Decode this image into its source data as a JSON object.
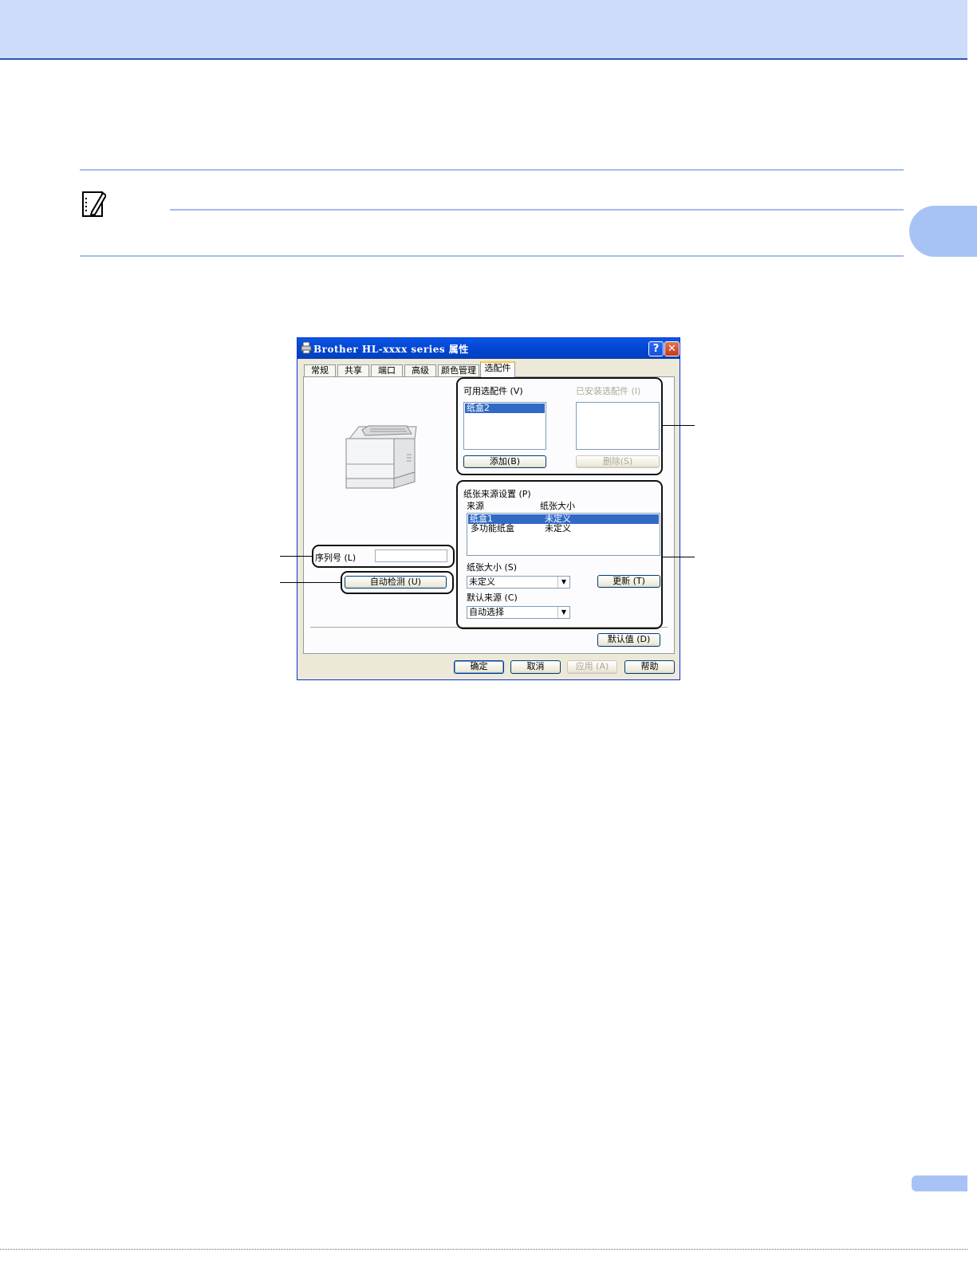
{
  "dialog": {
    "title": "Brother HL-xxxx series 属性",
    "help_button": "?",
    "close_button": "✕",
    "tabs": [
      "常规",
      "共享",
      "端口",
      "高级",
      "颜色管理",
      "选配件"
    ],
    "active_tab": "选配件"
  },
  "options": {
    "available_label": "可用选配件 (V)",
    "available_items": [
      "纸盒2"
    ],
    "installed_label": "已安装选配件 (I)",
    "add_button": "添加(B)",
    "remove_button": "删除(S)"
  },
  "paper_source": {
    "section_label": "纸张来源设置 (P)",
    "col_source": "来源",
    "col_size": "纸张大小",
    "rows": [
      {
        "source": "纸盒1",
        "size": "未定义",
        "selected": true
      },
      {
        "source": "多功能纸盒",
        "size": "未定义",
        "selected": false
      }
    ],
    "paper_size_label": "纸张大小 (S)",
    "paper_size_value": "未定义",
    "update_button": "更新 (T)",
    "default_source_label": "默认来源 (C)",
    "default_source_value": "自动选择"
  },
  "serial": {
    "label": "序列号 (L)",
    "value": ""
  },
  "auto_detect_button": "自动检测 (U)",
  "defaults_button": "默认值 (D)",
  "footer_buttons": {
    "ok": "确定",
    "cancel": "取消",
    "apply": "应用 (A)",
    "help": "帮助"
  },
  "colors": {
    "header_band": "#ccdcfa",
    "accent_rule": "#a4bdf0",
    "titlebar": "#0348d3",
    "selection": "#316ac5"
  }
}
